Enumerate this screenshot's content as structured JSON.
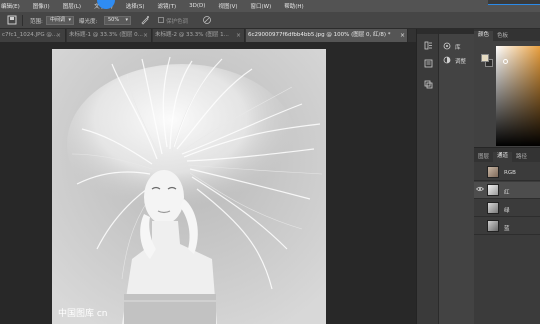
{
  "menu": {
    "items": [
      "编辑(E)",
      "图像(I)",
      "图层(L)",
      "文字(Y)",
      "选择(S)",
      "滤镜(T)",
      "3D(D)",
      "视图(V)",
      "窗口(W)",
      "帮助(H)"
    ]
  },
  "options": {
    "mode_label": "范围:",
    "mode_value": "中间调",
    "exposure_label": "曝光度:",
    "exposure_value": "50%",
    "protect_label": "保护色调"
  },
  "tabs": [
    {
      "label": "c7fc1_1024.JPG @...",
      "close": "×",
      "active": false
    },
    {
      "label": "未标题-1 @ 33.3% (图层 0...",
      "close": "×",
      "active": false
    },
    {
      "label": "未标题-2 @ 33.3% (图层 1...",
      "close": "×",
      "active": false
    },
    {
      "label": "6c29000977f6dfbb4bb5.jpg @ 100% (图层 0, 红/8) *",
      "close": "×",
      "active": true
    }
  ],
  "canvas": {
    "watermark": "中国图库 cn"
  },
  "side_strip": {
    "library_label": "库",
    "adjust_label": "调整"
  },
  "color_panel": {
    "tabs": [
      "颜色",
      "色板"
    ],
    "foreground": "#e6dcc3",
    "background": "#2c2c2c"
  },
  "channels_panel": {
    "tabs": [
      "图层",
      "通道",
      "路径"
    ],
    "rows": [
      {
        "label": "RGB",
        "visible": false,
        "selected": false
      },
      {
        "label": "红",
        "visible": true,
        "selected": true
      },
      {
        "label": "绿",
        "visible": false,
        "selected": false
      },
      {
        "label": "蓝",
        "visible": false,
        "selected": false
      }
    ]
  },
  "colors": {
    "accent": "#2f8cf2",
    "app_bg": "#282828",
    "panel_bg": "#3b3b3b"
  }
}
